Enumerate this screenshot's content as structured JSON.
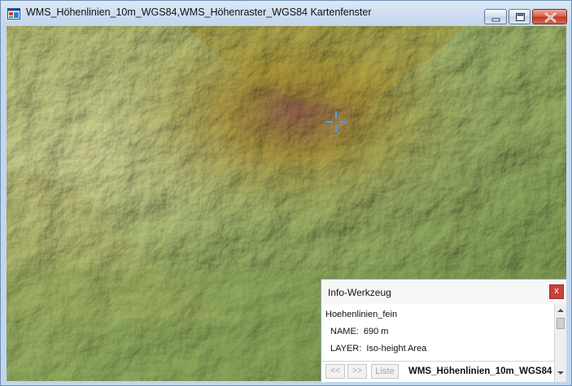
{
  "window": {
    "title": "WMS_Höhenlinien_10m_WGS84,WMS_Höhenraster_WGS84 Kartenfenster",
    "icon": "map-window-icon",
    "controls": [
      "minimize-icon",
      "maximize-icon",
      "close-icon"
    ]
  },
  "map": {
    "description_icon": "crosshair-icon",
    "colors": {
      "low": "#8fae5d",
      "mid": "#c9cf7c",
      "high": "#b5a33a",
      "peak": "#9e5a4f",
      "crosshair": "#2e7fc7"
    }
  },
  "info_panel": {
    "title": "Info-Werkzeug",
    "close_label": "x",
    "layer_name": "Hoehenlinien_fein",
    "attributes": [
      {
        "key": "NAME:",
        "value": "690 m"
      },
      {
        "key": "LAYER:",
        "value": "Iso-height Area"
      }
    ],
    "buttons": {
      "prev": "<<",
      "next": ">>",
      "list": "Liste"
    },
    "footer_layer": "WMS_Höhenlinien_10m_WGS84"
  }
}
